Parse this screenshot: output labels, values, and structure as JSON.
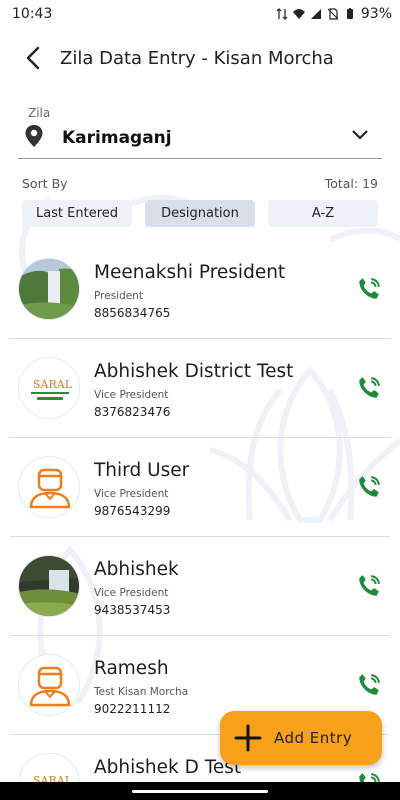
{
  "status_bar": {
    "time": "10:43",
    "battery": "93%"
  },
  "app_bar": {
    "title": "Zila Data Entry - Kisan Morcha",
    "back_icon": "arrow-left-icon"
  },
  "zila": {
    "label": "Zila",
    "value": "Karimaganj",
    "icon": "location-pin-icon"
  },
  "sort": {
    "label": "Sort By",
    "total": "Total: 19",
    "options": [
      "Last Entered",
      "Designation",
      "A-Z"
    ],
    "active": "Designation"
  },
  "entries": [
    {
      "name": "Meenakshi President",
      "designation": "President",
      "phone": "8856834765",
      "avatar": "waterfall-photo"
    },
    {
      "name": "Abhishek District Test",
      "designation": "Vice President",
      "phone": "8376823476",
      "avatar": "saral-logo"
    },
    {
      "name": "Third User",
      "designation": "Vice President",
      "phone": "9876543299",
      "avatar": "person-icon"
    },
    {
      "name": "Abhishek",
      "designation": "Vice President",
      "phone": "9438537453",
      "avatar": "waterfall-photo"
    },
    {
      "name": "Ramesh",
      "designation": "Test Kisan Morcha",
      "phone": "9022211112",
      "avatar": "person-icon"
    },
    {
      "name": "Abhishek D Test",
      "designation": "",
      "phone": "",
      "avatar": "saral-logo"
    }
  ],
  "fab": {
    "label": "Add Entry",
    "icon": "plus-icon"
  },
  "colors": {
    "accent": "#f7a11a",
    "call_green": "#1f8a3a",
    "person_orange": "#f07c1a",
    "chip_bg": "#eef1f8",
    "chip_active_bg": "#d9dfea"
  },
  "saral": {
    "logo_text": "SARAL"
  }
}
